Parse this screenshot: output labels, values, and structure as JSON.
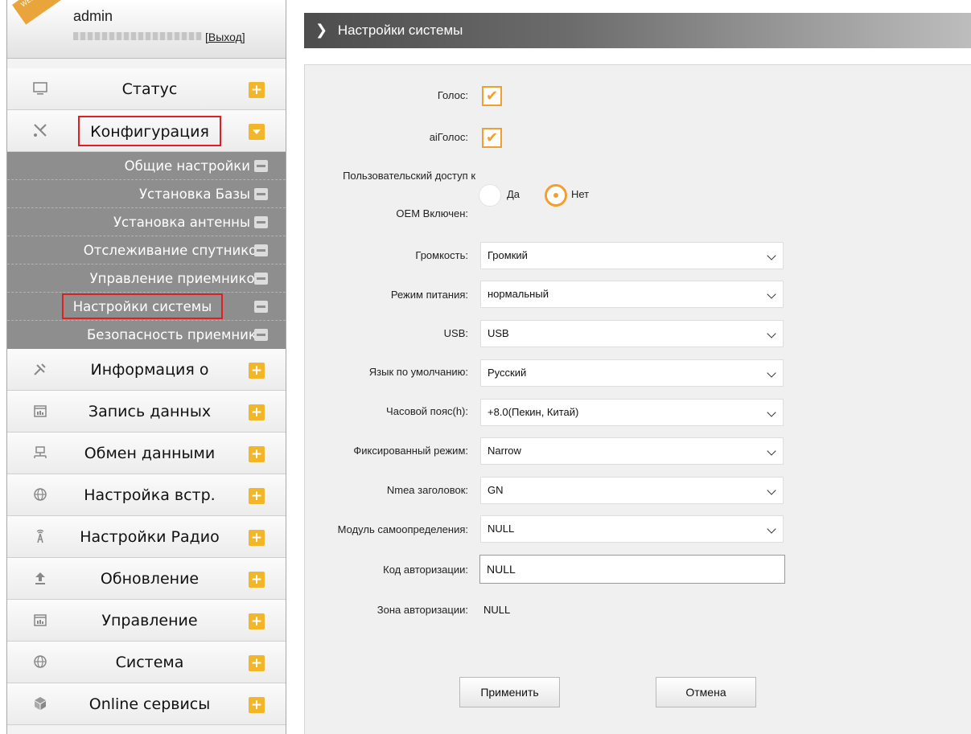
{
  "user": {
    "welcome": "WELCOME",
    "name": "admin",
    "logout": "[Выход]"
  },
  "sidebar": {
    "items": [
      {
        "label": "Статус",
        "icon": "monitor-icon"
      },
      {
        "label": "Конфигурация",
        "icon": "tools-icon",
        "expanded": true,
        "highlighted": true
      },
      {
        "label": "Информация о",
        "icon": "satellite-icon"
      },
      {
        "label": "Запись данных",
        "icon": "calendar-icon"
      },
      {
        "label": "Обмен данными",
        "icon": "network-icon"
      },
      {
        "label": "Настройка встр.",
        "icon": "globe-icon"
      },
      {
        "label": "Настройки Радио",
        "icon": "radio-tower-icon"
      },
      {
        "label": "Обновление",
        "icon": "upload-icon"
      },
      {
        "label": "Управление",
        "icon": "calendar-icon"
      },
      {
        "label": "Система",
        "icon": "globe-icon"
      },
      {
        "label": "Online сервисы",
        "icon": "cube-icon"
      }
    ],
    "submenu": [
      {
        "label": "Общие настройки"
      },
      {
        "label": "Установка Базы"
      },
      {
        "label": "Установка антенны"
      },
      {
        "label": "Отслеживание спутников"
      },
      {
        "label": "Управление приемником"
      },
      {
        "label": "Настройки системы",
        "selected": true
      },
      {
        "label": "Безопасность приемника"
      }
    ]
  },
  "header": {
    "title": "Настройки системы"
  },
  "form": {
    "voice": {
      "label": "Голос:",
      "checked": true
    },
    "ai_voice": {
      "label": "aiГолос:",
      "checked": true
    },
    "oem_access": {
      "label_line1": "Пользовательский доступ к",
      "label_line2": "OEM Включен:",
      "options": [
        "Да",
        "Нет"
      ],
      "selected": "Нет"
    },
    "volume": {
      "label": "Громкость:",
      "value": "Громкий"
    },
    "power_mode": {
      "label": "Режим питания:",
      "value": "нормальный"
    },
    "usb": {
      "label": "USB:",
      "value": "USB"
    },
    "language": {
      "label": "Язык по умолчанию:",
      "value": "Русский"
    },
    "timezone": {
      "label": "Часовой пояс(h):",
      "value": "+8.0(Пекин, Китай)"
    },
    "fixed_mode": {
      "label": "Фиксированный режим:",
      "value": "Narrow"
    },
    "nmea_header": {
      "label": "Nmea заголовок:",
      "value": "GN"
    },
    "self_detect": {
      "label": "Модуль самоопределения:",
      "value": "NULL"
    },
    "auth_code": {
      "label": "Код авторизации:",
      "value": "NULL"
    },
    "auth_zone": {
      "label": "Зона авторизации:",
      "value": "NULL"
    },
    "apply_label": "Применить",
    "cancel_label": "Отмена"
  },
  "colors": {
    "accent": "#f0a030",
    "plus_button": "#f2b62b",
    "submenu_bg": "#8e8e8e",
    "highlight_box": "#e02020"
  }
}
